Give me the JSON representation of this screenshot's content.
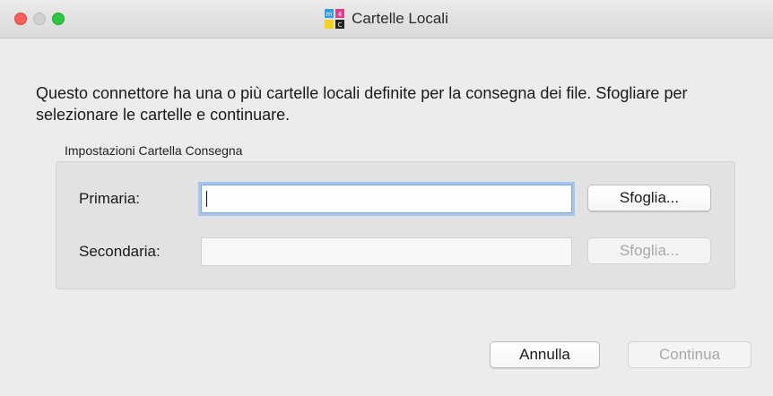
{
  "window": {
    "title": "Cartelle Locali",
    "logo_icon": "m4g-app-logo",
    "traffic_lights": [
      "close",
      "minimize",
      "zoom"
    ]
  },
  "message": "Questo connettore ha una o più cartelle locali definite per la consegna dei file. Sfogliare per selezionare le cartelle e continuare.",
  "group": {
    "label": "Impostazioni Cartella Consegna",
    "primary": {
      "label": "Primaria:",
      "value": "",
      "browse_label": "Sfoglia...",
      "enabled": true
    },
    "secondary": {
      "label": "Secondaria:",
      "value": "",
      "browse_label": "Sfoglia...",
      "enabled": false
    }
  },
  "buttons": {
    "cancel": "Annulla",
    "continue": "Continua",
    "continue_enabled": false
  },
  "colors": {
    "focus_ring": "#a4c5f0",
    "close": "#fc5f57",
    "zoom": "#2cc840"
  }
}
